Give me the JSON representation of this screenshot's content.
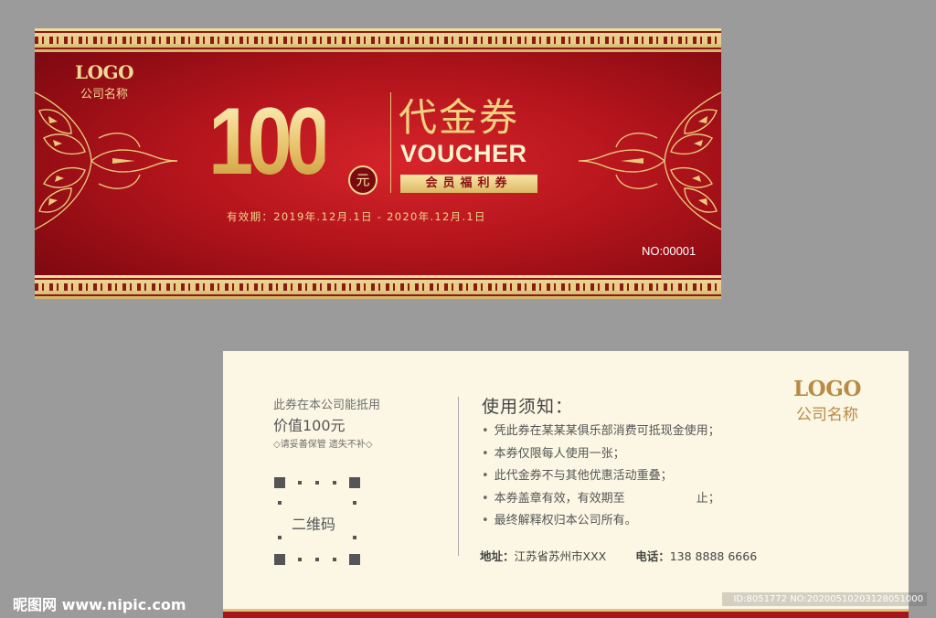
{
  "front": {
    "logo": "LOGO",
    "company": "公司名称",
    "amount": "100",
    "unit": "元",
    "title_cn": "代金券",
    "title_en": "VOUCHER",
    "member_tag": "会员福利券",
    "validity": "有效期：2019年.12月.1日 - 2020年.12月.1日",
    "serial": "NO:00001"
  },
  "back": {
    "accept_text": "此券在本公司能抵用",
    "value_text": "价值100元",
    "keep_text": "◇请妥善保管  遗失不补◇",
    "qr_label": "二维码",
    "notice_title": "使用须知：",
    "notices": [
      "凭此券在某某某俱乐部消费可抵现金使用；",
      "本券仅限每人使用一张；",
      "此代金券不与其他优惠活动重叠；",
      "本券盖章有效，有效期至",
      "最终解释权归本公司所有。"
    ],
    "notice_4_suffix": "止；",
    "bullet": "•",
    "address_label": "地址：",
    "address": "江苏省苏州市XXX",
    "phone_label": "电话：",
    "phone": "138 8888 6666",
    "logo": "LOGO",
    "company": "公司名称"
  },
  "watermark": {
    "left": "昵图网 www.nipic.com",
    "right": "ID:8051772 NO:20200510203128051000"
  },
  "colors": {
    "front_red": "#b3141c",
    "gold": "#f2d27e",
    "back_bg": "#fbf7e4",
    "back_logo_gold": "#b98a45",
    "canvas_gray": "#9b9b9b"
  }
}
